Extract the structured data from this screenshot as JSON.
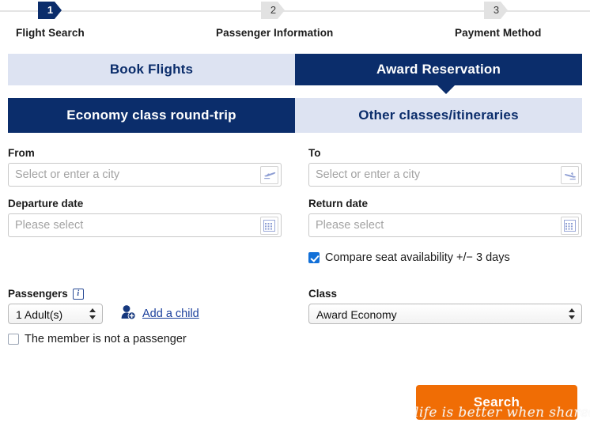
{
  "progress": {
    "steps": [
      {
        "number": "1",
        "label": "Flight Search",
        "state": "active"
      },
      {
        "number": "2",
        "label": "Passenger Information",
        "state": "inactive"
      },
      {
        "number": "3",
        "label": "Payment Method",
        "state": "inactive"
      }
    ]
  },
  "tabs": {
    "primary": [
      {
        "label": "Book Flights",
        "selected": false
      },
      {
        "label": "Award Reservation",
        "selected": true
      }
    ],
    "secondary": [
      {
        "label": "Economy class round-trip",
        "selected": true
      },
      {
        "label": "Other classes/itineraries",
        "selected": false
      }
    ]
  },
  "form": {
    "from": {
      "label": "From",
      "value": "",
      "placeholder": "Select or enter a city",
      "icon": "airplane-departure-icon"
    },
    "to": {
      "label": "To",
      "value": "",
      "placeholder": "Select or enter a city",
      "icon": "airplane-arrival-icon"
    },
    "departure_date": {
      "label": "Departure date",
      "value": "",
      "placeholder": "Please select",
      "icon": "calendar-icon"
    },
    "return_date": {
      "label": "Return date",
      "value": "",
      "placeholder": "Please select",
      "icon": "calendar-icon"
    },
    "compare_seats": {
      "label": "Compare seat availability +/− 3 days",
      "checked": true
    },
    "passengers": {
      "label": "Passengers",
      "info_icon": "info-icon",
      "adults_value": "1 Adult(s)",
      "add_child_label": "Add a child",
      "add_child_icon": "person-add-icon",
      "member_not_passenger_label": "The member is not a passenger",
      "member_not_passenger_checked": false
    },
    "class": {
      "label": "Class",
      "value": "Award Economy"
    }
  },
  "actions": {
    "search_label": "Search"
  },
  "watermark": {
    "text": "life is better when shared",
    "logo": "bird-wing-logo"
  },
  "colors": {
    "navy": "#0b2d6b",
    "light_tab": "#dde3f2",
    "orange": "#f06d05",
    "checkbox_blue": "#1270d8",
    "link_blue": "#1a3f9c",
    "icon_blue": "#8f9fd4"
  }
}
